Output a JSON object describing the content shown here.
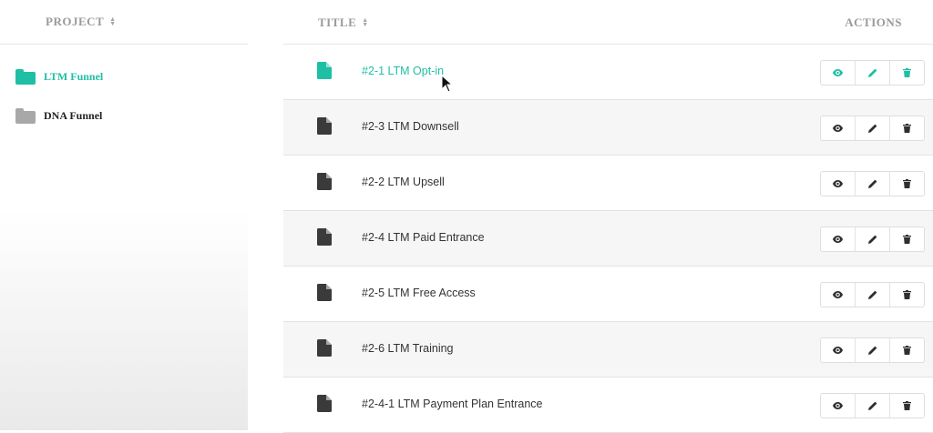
{
  "colors": {
    "accent": "#1fbfa5",
    "folder_inactive": "#a8a8a8",
    "text_dark": "#333333",
    "header_gray": "#9a9a9a"
  },
  "left": {
    "header": "PROJECT",
    "projects": [
      {
        "label": "LTM Funnel",
        "icon": "folder-icon",
        "active": true
      },
      {
        "label": "DNA Funnel",
        "icon": "folder-icon",
        "active": false
      }
    ]
  },
  "right": {
    "title_header": "TITLE",
    "actions_header": "ACTIONS",
    "rows": [
      {
        "title": "#2-1 LTM Opt-in",
        "active": true
      },
      {
        "title": "#2-3 LTM Downsell",
        "active": false
      },
      {
        "title": "#2-2 LTM Upsell",
        "active": false
      },
      {
        "title": "#2-4 LTM Paid Entrance",
        "active": false
      },
      {
        "title": "#2-5 LTM Free Access",
        "active": false
      },
      {
        "title": "#2-6 LTM Training",
        "active": false
      },
      {
        "title": "#2-4-1 LTM Payment Plan Entrance",
        "active": false
      }
    ],
    "actions": [
      "eye-icon",
      "pencil-icon",
      "trash-icon"
    ]
  }
}
